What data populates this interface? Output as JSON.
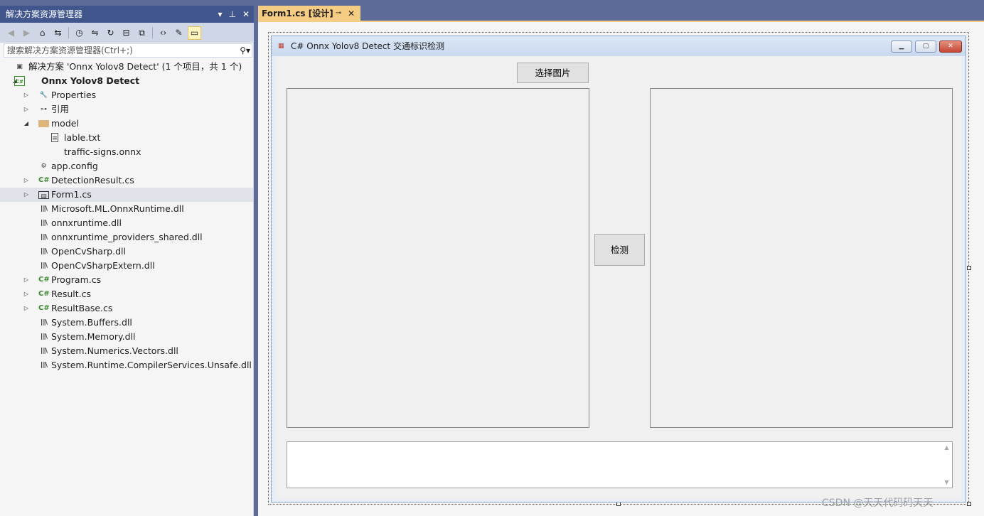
{
  "solution_explorer": {
    "title": "解决方案资源管理器",
    "title_buttons": [
      "▾",
      "⊥",
      "✕"
    ],
    "search_placeholder": "搜索解决方案资源管理器(Ctrl+;)",
    "toolbar_icons": [
      "back-icon",
      "forward-icon",
      "home-icon",
      "switch-views-icon",
      "history-icon",
      "sync-icon",
      "refresh-icon",
      "collapse-all-icon",
      "show-all-files-icon",
      "view-code-icon",
      "properties-icon",
      "preview-icon"
    ],
    "tree": [
      {
        "label": "解决方案 'Onnx Yolov8 Detect' (1 个项目，共 1 个)",
        "icon": "solution-icon",
        "level": 0,
        "expander": ""
      },
      {
        "label": "Onnx Yolov8 Detect",
        "icon": "csharp-project-icon",
        "level": 0,
        "expander": "expanded",
        "bold": true
      },
      {
        "label": "Properties",
        "icon": "wrench-icon",
        "level": 1,
        "expander": "collapsed"
      },
      {
        "label": "引用",
        "icon": "references-icon",
        "level": 1,
        "expander": "collapsed"
      },
      {
        "label": "model",
        "icon": "folder-icon",
        "level": 1,
        "expander": "expanded"
      },
      {
        "label": "lable.txt",
        "icon": "text-file-icon",
        "level": 2,
        "expander": ""
      },
      {
        "label": "traffic-signs.onnx",
        "icon": "",
        "level": 2,
        "expander": ""
      },
      {
        "label": "app.config",
        "icon": "config-icon",
        "level": 1,
        "expander": ""
      },
      {
        "label": "DetectionResult.cs",
        "icon": "csharp-file-icon",
        "level": 1,
        "expander": "collapsed"
      },
      {
        "label": "Form1.cs",
        "icon": "form-icon",
        "level": 1,
        "expander": "collapsed",
        "selected": true
      },
      {
        "label": "Microsoft.ML.OnnxRuntime.dll",
        "icon": "library-icon",
        "level": 1,
        "expander": ""
      },
      {
        "label": "onnxruntime.dll",
        "icon": "library-icon",
        "level": 1,
        "expander": ""
      },
      {
        "label": "onnxruntime_providers_shared.dll",
        "icon": "library-icon",
        "level": 1,
        "expander": ""
      },
      {
        "label": "OpenCvSharp.dll",
        "icon": "library-icon",
        "level": 1,
        "expander": ""
      },
      {
        "label": "OpenCvSharpExtern.dll",
        "icon": "library-icon",
        "level": 1,
        "expander": ""
      },
      {
        "label": "Program.cs",
        "icon": "csharp-file-icon",
        "level": 1,
        "expander": "collapsed"
      },
      {
        "label": "Result.cs",
        "icon": "csharp-file-icon",
        "level": 1,
        "expander": "collapsed"
      },
      {
        "label": "ResultBase.cs",
        "icon": "csharp-file-icon",
        "level": 1,
        "expander": "collapsed"
      },
      {
        "label": "System.Buffers.dll",
        "icon": "library-icon",
        "level": 1,
        "expander": ""
      },
      {
        "label": "System.Memory.dll",
        "icon": "library-icon",
        "level": 1,
        "expander": ""
      },
      {
        "label": "System.Numerics.Vectors.dll",
        "icon": "library-icon",
        "level": 1,
        "expander": ""
      },
      {
        "label": "System.Runtime.CompilerServices.Unsafe.dll",
        "icon": "library-icon",
        "level": 1,
        "expander": ""
      }
    ]
  },
  "editor_tab": {
    "label": "Form1.cs [设计]",
    "pin": "⊸",
    "close": "✕"
  },
  "form": {
    "title": "C# Onnx Yolov8 Detect 交通标识检测",
    "select_button": "选择图片",
    "detect_button": "检测",
    "output_text": ""
  },
  "watermark": "CSDN @天天代码码天天",
  "colors": {
    "accent": "#f5cc84",
    "titlebar": "#40568d",
    "chrome": "#5d6b99"
  }
}
